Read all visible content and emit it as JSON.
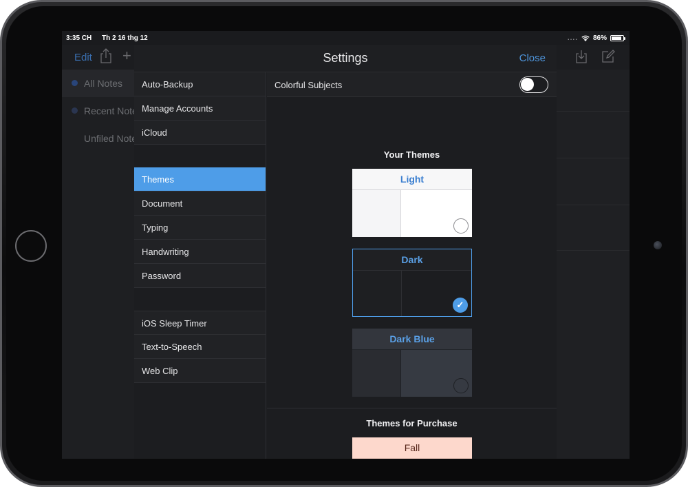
{
  "status_bar": {
    "time": "3:35 CH",
    "date": "Th 2 16 thg 12",
    "signal": "....",
    "battery": "86%",
    "battery_level": 0.86
  },
  "background_app": {
    "edit_label": "Edit",
    "nav_items": [
      {
        "label": "All Notes"
      },
      {
        "label": "Recent Notes"
      },
      {
        "label": "Unfiled Notes"
      }
    ],
    "bottom_icons": [
      "gear-icon",
      "help-icon",
      "info-icon"
    ]
  },
  "settings": {
    "title": "Settings",
    "close_label": "Close",
    "menu_groups": [
      [
        {
          "label": "Auto-Backup"
        },
        {
          "label": "Manage Accounts"
        },
        {
          "label": "iCloud"
        }
      ],
      [
        {
          "label": "Themes",
          "selected": true
        },
        {
          "label": "Document"
        },
        {
          "label": "Typing"
        },
        {
          "label": "Handwriting"
        },
        {
          "label": "Password"
        }
      ],
      [
        {
          "label": "iOS Sleep Timer"
        },
        {
          "label": "Text-to-Speech"
        },
        {
          "label": "Web Clip"
        }
      ]
    ],
    "colorful_subjects": {
      "label": "Colorful Subjects",
      "enabled": false
    },
    "your_themes_title": "Your Themes",
    "themes": [
      {
        "name": "Light",
        "selected": false
      },
      {
        "name": "Dark",
        "selected": true
      },
      {
        "name": "Dark Blue",
        "selected": false
      }
    ],
    "purchase_title": "Themes for Purchase",
    "purchase_themes": [
      {
        "name": "Fall"
      }
    ],
    "colors": {
      "accent": "#4e9de8",
      "background": "#1c1d20",
      "row": "#212225"
    }
  }
}
